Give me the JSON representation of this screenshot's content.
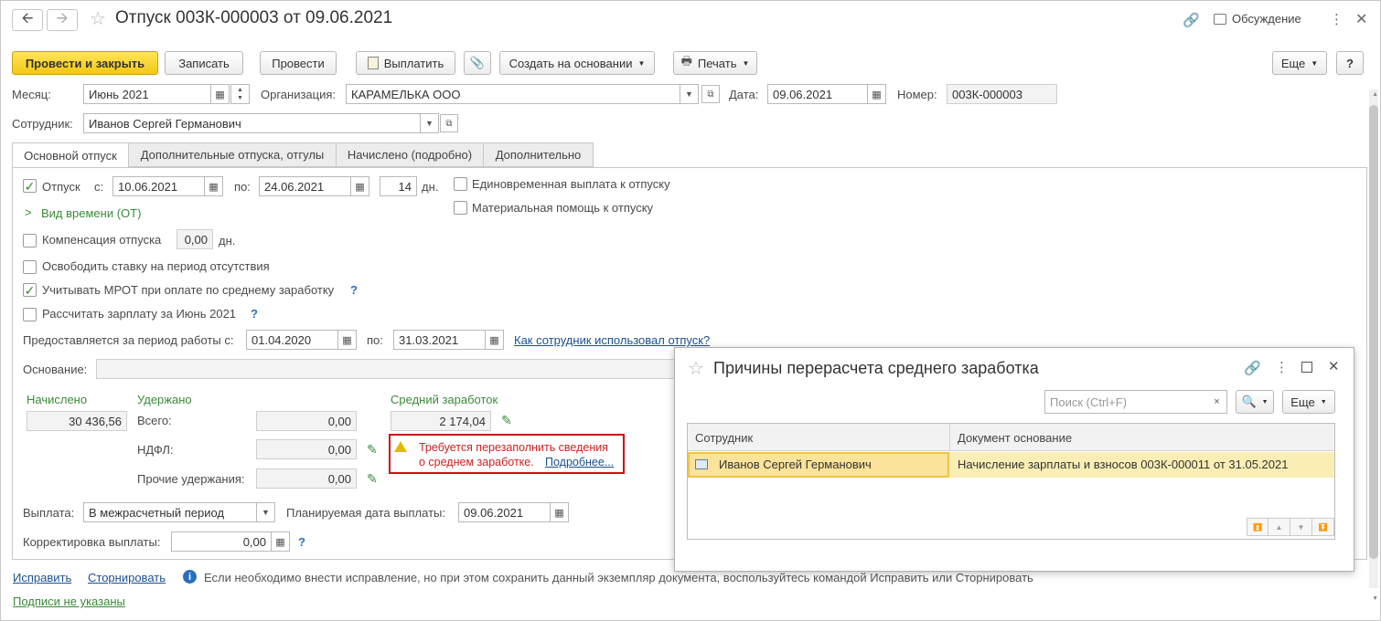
{
  "window": {
    "title": "Отпуск 003К-000003 от 09.06.2021",
    "discussion_label": "Обсуждение"
  },
  "toolbar": {
    "post_close": "Провести и закрыть",
    "save": "Записать",
    "post": "Провести",
    "pay": "Выплатить",
    "create_based": "Создать на основании",
    "print": "Печать",
    "more": "Еще",
    "help": "?"
  },
  "header": {
    "month_label": "Месяц:",
    "month_value": "Июнь 2021",
    "org_label": "Организация:",
    "org_value": "КАРАМЕЛЬКА ООО",
    "date_label": "Дата:",
    "date_value": "09.06.2021",
    "number_label": "Номер:",
    "number_value": "003К-000003",
    "employee_label": "Сотрудник:",
    "employee_value": "Иванов Сергей Германович"
  },
  "tabs": [
    {
      "label": "Основной отпуск",
      "active": true
    },
    {
      "label": "Дополнительные отпуска, отгулы",
      "active": false
    },
    {
      "label": "Начислено (подробно)",
      "active": false
    },
    {
      "label": "Дополнительно",
      "active": false
    }
  ],
  "main": {
    "vacation_label": "Отпуск",
    "vacation_checked": true,
    "from_label": "с:",
    "from_value": "10.06.2021",
    "to_label": "по:",
    "to_value": "24.06.2021",
    "days_value": "14",
    "days_unit": "дн.",
    "lump_sum_label": "Единовременная выплата к отпуску",
    "material_help_label": "Материальная помощь к отпуску",
    "time_type_label": "Вид времени (ОТ)",
    "compensation_label": "Компенсация отпуска",
    "compensation_value": "0,00",
    "compensation_unit": "дн.",
    "release_rate_label": "Освободить ставку на период отсутствия",
    "mrot_label": "Учитывать МРОТ при оплате по среднему заработку",
    "mrot_checked": true,
    "calc_salary_label": "Рассчитать зарплату за Июнь 2021",
    "period_label": "Предоставляется за период работы с:",
    "period_from": "01.04.2020",
    "period_to_label": "по:",
    "period_to": "31.03.2021",
    "usage_link": "Как сотрудник использовал отпуск?",
    "basis_label": "Основание:",
    "basis_value": "",
    "accrued_header": "Начислено",
    "accrued_value": "30 436,56",
    "withheld_header": "Удержано",
    "total_label": "Всего:",
    "total_value": "0,00",
    "ndfl_label": "НДФЛ:",
    "ndfl_value": "0,00",
    "other_label": "Прочие удержания:",
    "other_value": "0,00",
    "avg_header": "Средний заработок",
    "avg_value": "2 174,04",
    "warning_line1": "Требуется перезаполнить сведения",
    "warning_line2": "о среднем заработке.",
    "warning_link": "Подробнее...",
    "payment_label": "Выплата:",
    "payment_value": "В межрасчетный период",
    "planned_date_label": "Планируемая дата выплаты:",
    "planned_date_value": "09.06.2021",
    "correction_label": "Корректировка выплаты:",
    "correction_value": "0,00"
  },
  "footer": {
    "fix_link": "Исправить",
    "reverse_link": "Сторнировать",
    "info_text": "Если необходимо внести исправление, но при этом сохранить данный экземпляр документа, воспользуйтесь командой Исправить или Сторнировать",
    "signatures_link": "Подписи не указаны"
  },
  "dialog": {
    "title": "Причины перерасчета среднего заработка",
    "search_placeholder": "Поиск (Ctrl+F)",
    "more_label": "Еще",
    "columns": [
      "Сотрудник",
      "Документ основание"
    ],
    "rows": [
      {
        "employee": "Иванов Сергей Германович",
        "document": "Начисление зарплаты и взносов 003К-000011 от 31.05.2021"
      }
    ]
  },
  "colors": {
    "primary_button": "#f3c812",
    "warning_border": "#cc1111",
    "warning_text": "#cc2222",
    "green_label": "#3a8a3a",
    "selected_row": "#fbeeb5"
  }
}
